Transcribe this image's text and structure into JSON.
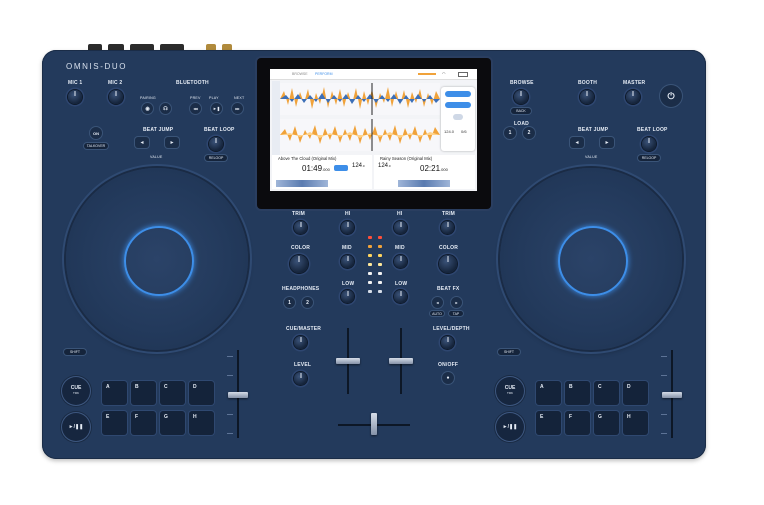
{
  "device": {
    "brand": "OMNIS-DUO",
    "left_deck": {
      "mic1": "MIC 1",
      "mic2": "MIC 2",
      "bluetooth": "BLUETOOTH",
      "bt_sub": [
        "PAIRING",
        "PREV",
        "PLAY",
        "NEXT"
      ],
      "talkover": "ON",
      "talkover_sub": "TALKOVER",
      "beat_jump": "BEAT JUMP",
      "beat_jump_sub": "VALUE",
      "beat_loop": "BEAT LOOP",
      "beat_loop_sub": "RELOOP",
      "shift": "SHIFT",
      "cue": "CUE",
      "cue_sub": "TRK",
      "play": "►/❚❚",
      "pads": [
        "A",
        "B",
        "C",
        "D",
        "E",
        "F",
        "G",
        "H"
      ]
    },
    "right_deck": {
      "browse": "BROWSE",
      "browse_sub": "BACK",
      "booth": "BOOTH",
      "master": "MASTER",
      "load": "LOAD",
      "load_buttons": [
        "1",
        "2"
      ],
      "beat_jump": "BEAT JUMP",
      "beat_jump_sub": "VALUE",
      "beat_loop": "BEAT LOOP",
      "beat_loop_sub": "RELOOP",
      "shift": "SHIFT",
      "cue": "CUE",
      "cue_sub": "TRK",
      "play": "►/❚❚",
      "pads": [
        "A",
        "B",
        "C",
        "D",
        "E",
        "F",
        "G",
        "H"
      ]
    },
    "mixer": {
      "trim": "TRIM",
      "hi": "HI",
      "mid": "MID",
      "low": "LOW",
      "color": "COLOR",
      "headphones": "HEADPHONES",
      "hp_buttons": [
        "1",
        "2"
      ],
      "beat_fx": "BEAT FX",
      "beat_fx_sub": [
        "AUTO",
        "TAP"
      ],
      "cue_master": "CUE/MASTER",
      "level": "LEVEL",
      "level_depth": "LEVEL/DEPTH",
      "on_off": "ON/OFF"
    },
    "screen": {
      "tabs": [
        "BROWSE",
        "PERFORM"
      ],
      "deck1": {
        "title": "Above The Cloud (Original Mix)",
        "time": "01:49",
        "time_ms": ".000",
        "bpm": "124",
        "bpm_dec": ".0"
      },
      "deck2": {
        "title": "Rainy Season (Original Mix)",
        "time": "02:21",
        "time_ms": ".000",
        "bpm": "124",
        "bpm_dec": ".0"
      },
      "side_panel": {
        "values": [
          "124.0",
          "0/6"
        ]
      }
    },
    "colors": {
      "body": "#233a5c",
      "accent_blue": "#3d8ee8",
      "waveform_orange": "#f0a23a",
      "waveform_blue": "#3c6fb8"
    }
  }
}
